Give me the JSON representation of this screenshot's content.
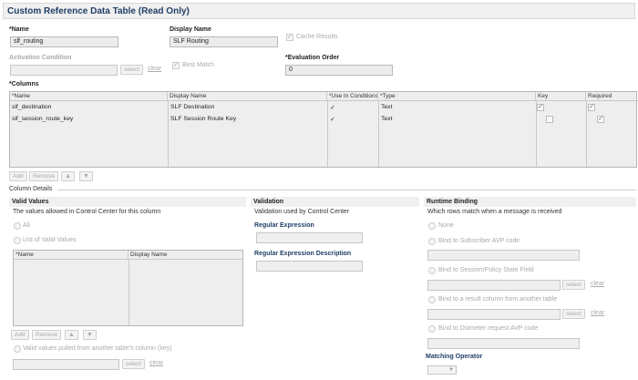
{
  "title": "Custom Reference Data Table (Read Only)",
  "name": {
    "label": "*Name",
    "value": "slf_routing"
  },
  "display_name": {
    "label": "Display Name",
    "value": "SLF Routing"
  },
  "cache_results": {
    "label": "Cache Results",
    "checked": true
  },
  "activation_condition": {
    "label": "Activation Condition",
    "select_label": "select",
    "clear_label": "clear"
  },
  "best_match": {
    "label": "Best Match",
    "checked": true
  },
  "evaluation_order": {
    "label": "*Evaluation Order",
    "value": "0"
  },
  "columns": {
    "label": "*Columns",
    "headers": [
      "*Name",
      "Display Name",
      "*Use In Conditions",
      "*Type",
      "Key",
      "Required"
    ],
    "rows": [
      {
        "name": "slf_destination",
        "display_name": "SLF Destination",
        "use_in_conditions": "✓",
        "type": "Text",
        "key": "✓",
        "required": "✓"
      },
      {
        "name": "slf_session_route_key",
        "display_name": "SLF Session Route Key",
        "use_in_conditions": "✓",
        "type": "Text",
        "key": "",
        "required": "✓"
      }
    ],
    "add_label": "Add",
    "remove_label": "Remove",
    "up_icon": "arrow-up-icon",
    "down_icon": "arrow-down-icon"
  },
  "column_details": {
    "label": "Column Details"
  },
  "valid_values": {
    "title": "Valid Values",
    "description": "The values allowed in Control Center for this column",
    "radio_all": "All",
    "radio_list": "List of Valid Values",
    "grid_headers": [
      "*Name",
      "Display Name"
    ],
    "add_label": "Add",
    "remove_label": "Remove",
    "radio_pulled": "Valid values pulled from another table's column (key)",
    "select_label": "select",
    "clear_label": "clear"
  },
  "validation": {
    "title": "Validation",
    "description": "Validation used by Control Center",
    "regex_label": "Regular Expression",
    "regex_desc_label": "Regular Expression Description"
  },
  "runtime_binding": {
    "title": "Runtime Binding",
    "description": "Which rows match when a message is received",
    "radio_none": "None",
    "radio_subscriber": "Bind to Subscriber AVP code",
    "radio_session": "Bind to Session/Policy State Field",
    "radio_result": "Bind to a result column from another table",
    "radio_diameter": "Bind to Diameter request AVP code",
    "select_label": "select",
    "clear_label": "clear",
    "matching_operator_label": "Matching Operator"
  }
}
